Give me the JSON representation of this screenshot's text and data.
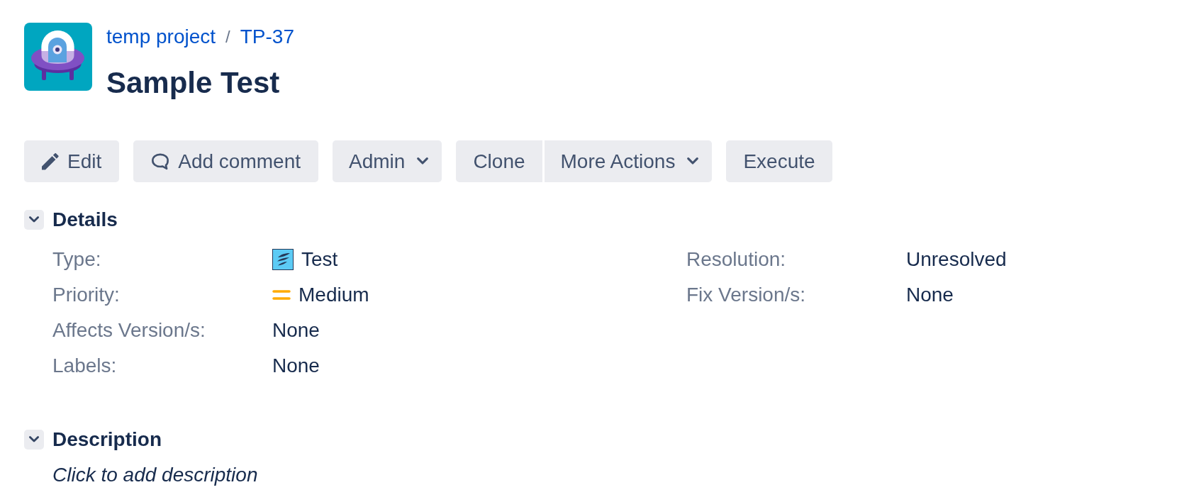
{
  "breadcrumbs": {
    "items": [
      {
        "label": "temp project"
      },
      {
        "label": "TP-37"
      }
    ],
    "separator": "/"
  },
  "title": "Sample Test",
  "toolbar": [
    {
      "buttons": [
        {
          "label": "Edit",
          "kind": "edit"
        }
      ]
    },
    {
      "buttons": [
        {
          "label": "Add comment",
          "kind": "comment"
        }
      ]
    },
    {
      "buttons": [
        {
          "label": "Admin",
          "kind": "dropdown"
        }
      ]
    },
    {
      "buttons": [
        {
          "label": "Clone",
          "kind": "plain"
        },
        {
          "label": "More Actions",
          "kind": "dropdown"
        }
      ]
    },
    {
      "buttons": [
        {
          "label": "Execute",
          "kind": "plain"
        }
      ]
    }
  ],
  "sections": [
    {
      "title": "Details",
      "expanded": true,
      "kind": "fields",
      "columns": [
        [
          {
            "label": "Type:",
            "value": "Test",
            "kind": "issue-type"
          },
          {
            "label": "Priority:",
            "value": "Medium",
            "kind": "priority"
          },
          {
            "label": "Affects Version/s:",
            "value": "None",
            "kind": "plain"
          },
          {
            "label": "Labels:",
            "value": "None",
            "kind": "plain"
          }
        ],
        [
          {
            "label": "Resolution:",
            "value": "Unresolved",
            "kind": "plain"
          },
          {
            "label": "Fix Version/s:",
            "value": "None",
            "kind": "plain"
          }
        ]
      ]
    },
    {
      "title": "Description",
      "expanded": true,
      "kind": "text",
      "prompt": "Click to add description"
    }
  ]
}
